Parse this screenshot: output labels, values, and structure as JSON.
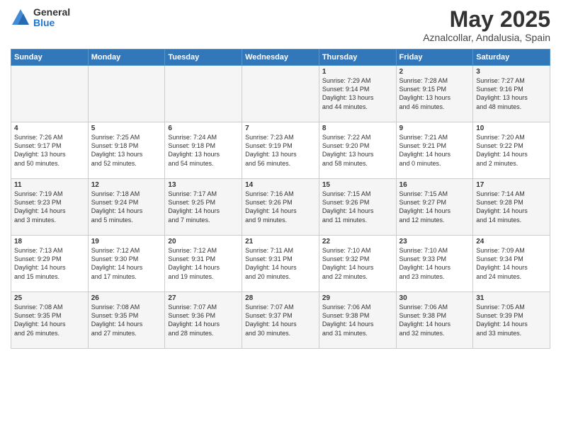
{
  "logo": {
    "general": "General",
    "blue": "Blue"
  },
  "title": "May 2025",
  "subtitle": "Aznalcollar, Andalusia, Spain",
  "days_of_week": [
    "Sunday",
    "Monday",
    "Tuesday",
    "Wednesday",
    "Thursday",
    "Friday",
    "Saturday"
  ],
  "weeks": [
    [
      {
        "day": "",
        "info": ""
      },
      {
        "day": "",
        "info": ""
      },
      {
        "day": "",
        "info": ""
      },
      {
        "day": "",
        "info": ""
      },
      {
        "day": "1",
        "info": "Sunrise: 7:29 AM\nSunset: 9:14 PM\nDaylight: 13 hours\nand 44 minutes."
      },
      {
        "day": "2",
        "info": "Sunrise: 7:28 AM\nSunset: 9:15 PM\nDaylight: 13 hours\nand 46 minutes."
      },
      {
        "day": "3",
        "info": "Sunrise: 7:27 AM\nSunset: 9:16 PM\nDaylight: 13 hours\nand 48 minutes."
      }
    ],
    [
      {
        "day": "4",
        "info": "Sunrise: 7:26 AM\nSunset: 9:17 PM\nDaylight: 13 hours\nand 50 minutes."
      },
      {
        "day": "5",
        "info": "Sunrise: 7:25 AM\nSunset: 9:18 PM\nDaylight: 13 hours\nand 52 minutes."
      },
      {
        "day": "6",
        "info": "Sunrise: 7:24 AM\nSunset: 9:18 PM\nDaylight: 13 hours\nand 54 minutes."
      },
      {
        "day": "7",
        "info": "Sunrise: 7:23 AM\nSunset: 9:19 PM\nDaylight: 13 hours\nand 56 minutes."
      },
      {
        "day": "8",
        "info": "Sunrise: 7:22 AM\nSunset: 9:20 PM\nDaylight: 13 hours\nand 58 minutes."
      },
      {
        "day": "9",
        "info": "Sunrise: 7:21 AM\nSunset: 9:21 PM\nDaylight: 14 hours\nand 0 minutes."
      },
      {
        "day": "10",
        "info": "Sunrise: 7:20 AM\nSunset: 9:22 PM\nDaylight: 14 hours\nand 2 minutes."
      }
    ],
    [
      {
        "day": "11",
        "info": "Sunrise: 7:19 AM\nSunset: 9:23 PM\nDaylight: 14 hours\nand 3 minutes."
      },
      {
        "day": "12",
        "info": "Sunrise: 7:18 AM\nSunset: 9:24 PM\nDaylight: 14 hours\nand 5 minutes."
      },
      {
        "day": "13",
        "info": "Sunrise: 7:17 AM\nSunset: 9:25 PM\nDaylight: 14 hours\nand 7 minutes."
      },
      {
        "day": "14",
        "info": "Sunrise: 7:16 AM\nSunset: 9:26 PM\nDaylight: 14 hours\nand 9 minutes."
      },
      {
        "day": "15",
        "info": "Sunrise: 7:15 AM\nSunset: 9:26 PM\nDaylight: 14 hours\nand 11 minutes."
      },
      {
        "day": "16",
        "info": "Sunrise: 7:15 AM\nSunset: 9:27 PM\nDaylight: 14 hours\nand 12 minutes."
      },
      {
        "day": "17",
        "info": "Sunrise: 7:14 AM\nSunset: 9:28 PM\nDaylight: 14 hours\nand 14 minutes."
      }
    ],
    [
      {
        "day": "18",
        "info": "Sunrise: 7:13 AM\nSunset: 9:29 PM\nDaylight: 14 hours\nand 15 minutes."
      },
      {
        "day": "19",
        "info": "Sunrise: 7:12 AM\nSunset: 9:30 PM\nDaylight: 14 hours\nand 17 minutes."
      },
      {
        "day": "20",
        "info": "Sunrise: 7:12 AM\nSunset: 9:31 PM\nDaylight: 14 hours\nand 19 minutes."
      },
      {
        "day": "21",
        "info": "Sunrise: 7:11 AM\nSunset: 9:31 PM\nDaylight: 14 hours\nand 20 minutes."
      },
      {
        "day": "22",
        "info": "Sunrise: 7:10 AM\nSunset: 9:32 PM\nDaylight: 14 hours\nand 22 minutes."
      },
      {
        "day": "23",
        "info": "Sunrise: 7:10 AM\nSunset: 9:33 PM\nDaylight: 14 hours\nand 23 minutes."
      },
      {
        "day": "24",
        "info": "Sunrise: 7:09 AM\nSunset: 9:34 PM\nDaylight: 14 hours\nand 24 minutes."
      }
    ],
    [
      {
        "day": "25",
        "info": "Sunrise: 7:08 AM\nSunset: 9:35 PM\nDaylight: 14 hours\nand 26 minutes."
      },
      {
        "day": "26",
        "info": "Sunrise: 7:08 AM\nSunset: 9:35 PM\nDaylight: 14 hours\nand 27 minutes."
      },
      {
        "day": "27",
        "info": "Sunrise: 7:07 AM\nSunset: 9:36 PM\nDaylight: 14 hours\nand 28 minutes."
      },
      {
        "day": "28",
        "info": "Sunrise: 7:07 AM\nSunset: 9:37 PM\nDaylight: 14 hours\nand 30 minutes."
      },
      {
        "day": "29",
        "info": "Sunrise: 7:06 AM\nSunset: 9:38 PM\nDaylight: 14 hours\nand 31 minutes."
      },
      {
        "day": "30",
        "info": "Sunrise: 7:06 AM\nSunset: 9:38 PM\nDaylight: 14 hours\nand 32 minutes."
      },
      {
        "day": "31",
        "info": "Sunrise: 7:05 AM\nSunset: 9:39 PM\nDaylight: 14 hours\nand 33 minutes."
      }
    ]
  ]
}
